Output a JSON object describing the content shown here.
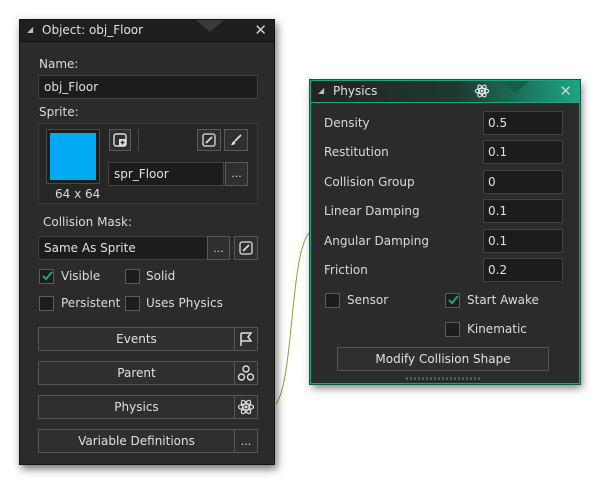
{
  "object_panel": {
    "title": "Object: obj_Floor",
    "name_label": "Name:",
    "name_value": "obj_Floor",
    "sprite_label": "Sprite:",
    "sprite_color": "#00aaf3",
    "sprite_size": "64 x 64",
    "sprite_name": "spr_Floor",
    "browse_label": "...",
    "collision_mask_label": "Collision Mask:",
    "collision_mask_value": "Same As Sprite",
    "checkboxes": {
      "visible": "Visible",
      "solid": "Solid",
      "persistent": "Persistent",
      "uses_physics": "Uses Physics"
    },
    "buttons": {
      "events": "Events",
      "parent": "Parent",
      "physics": "Physics",
      "variable_definitions": "Variable Definitions"
    }
  },
  "physics_panel": {
    "title": "Physics",
    "accent_color": "#1aa681",
    "fields": [
      {
        "label": "Density",
        "value": "0.5"
      },
      {
        "label": "Restitution",
        "value": "0.1"
      },
      {
        "label": "Collision Group",
        "value": "0"
      },
      {
        "label": "Linear Damping",
        "value": "0.1"
      },
      {
        "label": "Angular Damping",
        "value": "0.1"
      },
      {
        "label": "Friction",
        "value": "0.2"
      }
    ],
    "sensor_label": "Sensor",
    "start_awake_label": "Start Awake",
    "kinematic_label": "Kinematic",
    "modify_button": "Modify Collision Shape"
  }
}
